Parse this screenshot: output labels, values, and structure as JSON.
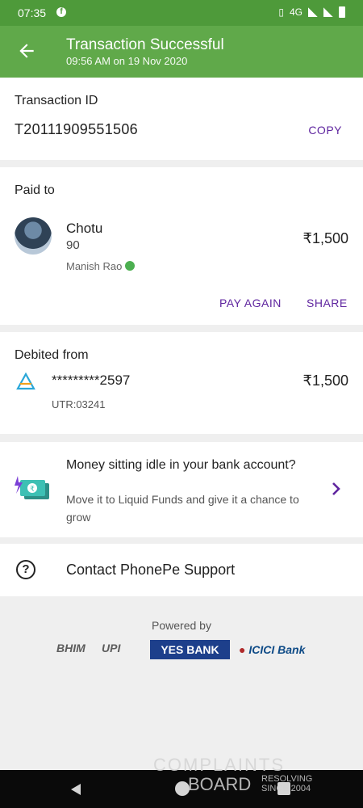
{
  "status_bar": {
    "time": "07:35",
    "network": "4G"
  },
  "header": {
    "title": "Transaction Successful",
    "subtitle": "09:56 AM on 19 Nov 2020"
  },
  "transaction": {
    "label": "Transaction ID",
    "id": "T20111909551506",
    "copy_label": "COPY"
  },
  "paid_to": {
    "label": "Paid to",
    "name": "Chotu",
    "phone": "90",
    "bank_name": "Manish Rao",
    "amount": "₹1,500",
    "pay_again_label": "PAY AGAIN",
    "share_label": "SHARE"
  },
  "debited_from": {
    "label": "Debited from",
    "account": "*********2597",
    "utr": "UTR:03241",
    "amount": "₹1,500"
  },
  "promo": {
    "title": "Money sitting idle in your bank account?",
    "subtitle": "Move it to Liquid Funds and give it a chance to grow"
  },
  "support": {
    "label": "Contact PhonePe Support"
  },
  "footer": {
    "powered_by": "Powered by",
    "partners": [
      "BHIM",
      "UPI",
      "YES BANK",
      "ICICI Bank"
    ]
  },
  "watermark": {
    "line1": "COMPLAINTS",
    "line2": "BOARD",
    "tagline1": "RESOLVING",
    "tagline2": "SINCE 2004"
  },
  "colors": {
    "accent": "#60a94a",
    "link": "#5f259f"
  }
}
